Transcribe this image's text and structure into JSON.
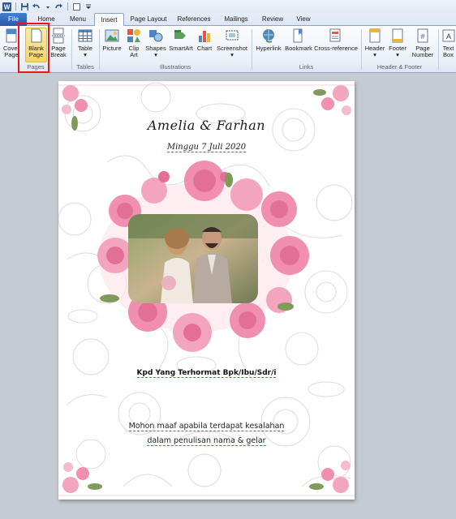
{
  "qat": {
    "icons": [
      "word-app-icon",
      "save-icon",
      "undo-icon",
      "redo-icon",
      "customize-qat-icon"
    ]
  },
  "tabs": [
    {
      "label": "File"
    },
    {
      "label": "Home"
    },
    {
      "label": "Menu"
    },
    {
      "label": "Insert"
    },
    {
      "label": "Page Layout"
    },
    {
      "label": "References"
    },
    {
      "label": "Mailings"
    },
    {
      "label": "Review"
    },
    {
      "label": "View"
    }
  ],
  "ribbon": {
    "cover_page": "Cover\nPage",
    "cover_page_l1": "Cover",
    "cover_page_l2": "Page",
    "blank_page_l1": "Blank",
    "blank_page_l2": "Page",
    "page_break_l1": "Page",
    "page_break_l2": "Break",
    "table": "Table",
    "picture": "Picture",
    "clip_art_l1": "Clip",
    "clip_art_l2": "Art",
    "shapes": "Shapes",
    "smartart": "SmartArt",
    "chart": "Chart",
    "screenshot": "Screenshot",
    "hyperlink": "Hyperlink",
    "bookmark": "Bookmark",
    "cross_reference": "Cross-reference",
    "header": "Header",
    "footer": "Footer",
    "page_number_l1": "Page",
    "page_number_l2": "Number",
    "text_box_l1": "Text",
    "text_box_l2": "Box",
    "groups": {
      "pages": "Pages",
      "tables": "Tables",
      "illustrations": "Illustrations",
      "links": "Links",
      "header_footer": "Header & Footer"
    },
    "highlight_color": "#e8151b"
  },
  "document": {
    "title": "Amelia & Farhan",
    "date": "Minggu 7 Juli 2020",
    "recipient": "Kpd Yang Terhormat Bpk/Ibu/Sdr/i",
    "apology_line1": "Mohon maaf apabila terdapat kesalahan",
    "apology_line2": "dalam penulisan nama & gelar",
    "rose_color": "#f08fb0",
    "leaf_color": "#7f9a5a"
  }
}
